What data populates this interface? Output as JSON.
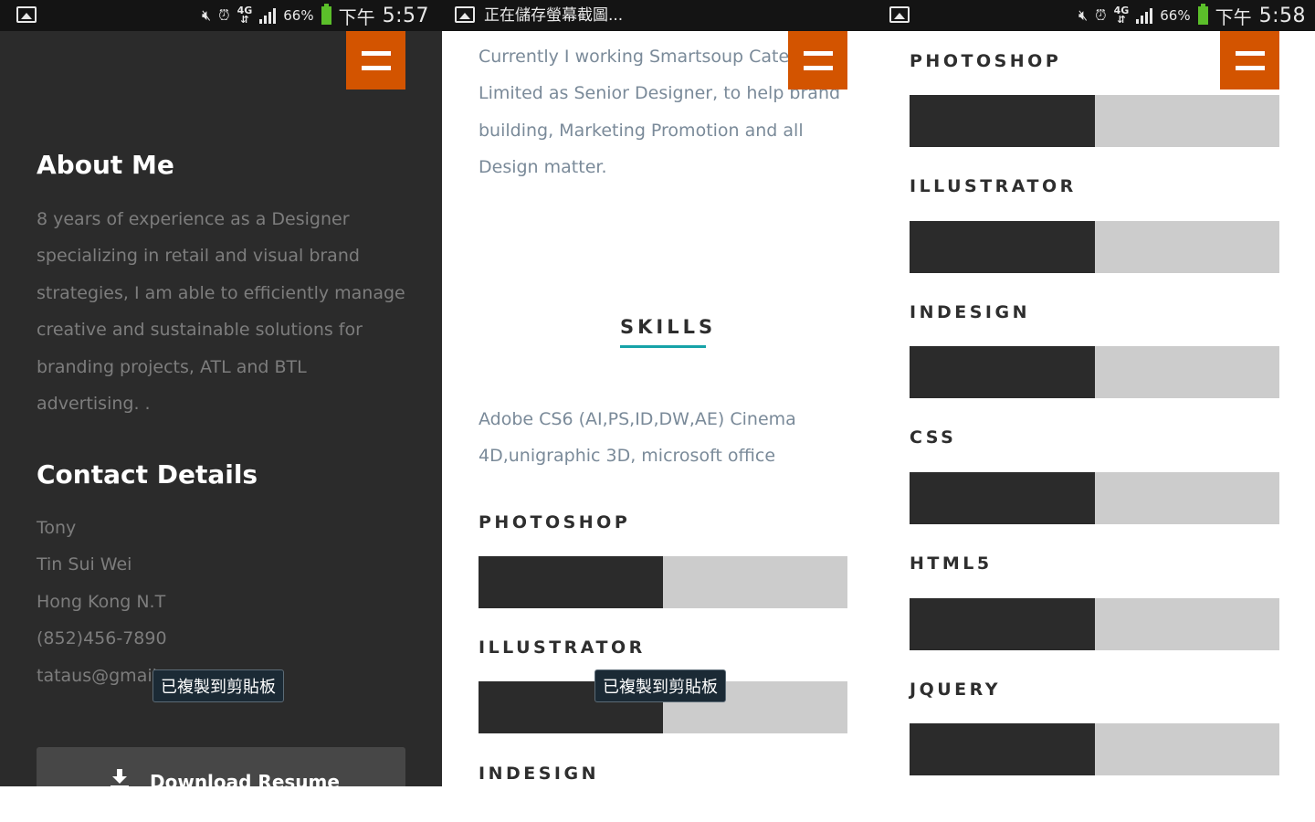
{
  "status_left": {
    "ampm": "下午",
    "time": "5:57",
    "battery": "66%",
    "network": "4G"
  },
  "status_mid": {
    "title": "正在儲存螢幕截圖..."
  },
  "status_right": {
    "ampm": "下午",
    "time": "5:58",
    "battery": "66%",
    "network": "4G"
  },
  "about": {
    "heading": "About Me",
    "lines": [
      "8 years of experience as a Designer",
      "specializing in retail and visual brand",
      "strategies, I am able to efficiently manage",
      "creative and sustainable solutions for",
      "branding projects, ATL and BTL",
      "advertising. ."
    ]
  },
  "contact": {
    "heading": "Contact Details",
    "lines": [
      "Tony",
      "Tin Sui Wei",
      "Hong Kong N.T",
      "(852)456-7890",
      "tataus@gmail"
    ]
  },
  "toast": {
    "text": "已複製到剪貼板"
  },
  "download": {
    "label": "Download Resume"
  },
  "work": {
    "lines": [
      "Currently I working Smartsoup Cater",
      "Limited as Senior Designer, to help brand",
      "building, Marketing Promotion and all",
      "Design matter."
    ]
  },
  "skills": {
    "title": "SKILLS",
    "intro_lines": [
      "Adobe CS6 (AI,PS,ID,DW,AE) Cinema",
      "4D,unigraphic 3D, microsoft office"
    ],
    "items": [
      {
        "name": "PHOTOSHOP",
        "level": 0.5
      },
      {
        "name": "ILLUSTRATOR",
        "level": 0.5
      },
      {
        "name": "INDESIGN",
        "level": 0.5
      },
      {
        "name": "CSS",
        "level": 0.5
      },
      {
        "name": "HTML5",
        "level": 0.5
      },
      {
        "name": "JQUERY",
        "level": 0.5
      }
    ]
  },
  "colors": {
    "accent": "#d35400",
    "underline": "#16a3a8",
    "bar_fill": "#2b2b2b",
    "bar_track": "#cccccc",
    "dark_panel": "#2b2b2b"
  }
}
